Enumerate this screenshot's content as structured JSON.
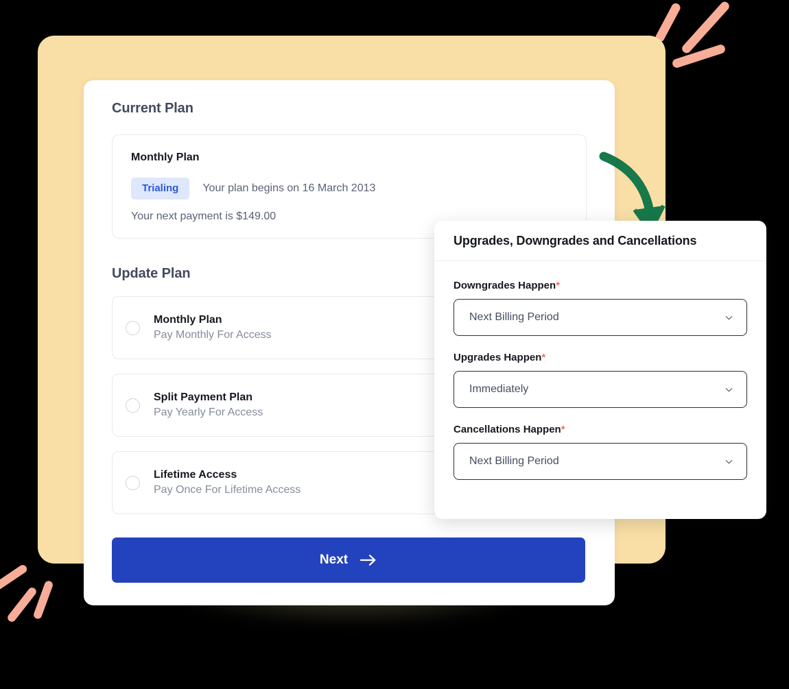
{
  "colors": {
    "background": "#000000",
    "card_yellow": "#F9DFA6",
    "panel_white": "#FFFFFF",
    "primary_blue": "#2343BE",
    "badge_bg": "#DEE7FB",
    "badge_text": "#2E5BD8",
    "arrow_green": "#17784A",
    "coral": "#F7AD97",
    "required_red": "#FF6B5E",
    "heading_slate": "#424A5E",
    "muted_text": "#858C9C"
  },
  "main": {
    "current_plan": {
      "section_title": "Current Plan",
      "plan_name": "Monthly Plan",
      "status_badge": "Trialing",
      "begins_text": "Your plan begins on 16 March 2013",
      "next_payment_text": "Your next payment is $149.00"
    },
    "update_plan": {
      "section_title": "Update Plan",
      "options": [
        {
          "name": "Monthly Plan",
          "description": "Pay Monthly For Access",
          "selected": false
        },
        {
          "name": "Split Payment Plan",
          "description": "Pay Yearly For Access",
          "selected": false
        },
        {
          "name": "Lifetime Access",
          "description": "Pay Once For Lifetime Access",
          "selected": false
        }
      ]
    },
    "next_button": {
      "label": "Next",
      "icon": "arrow-right-icon"
    }
  },
  "settings_panel": {
    "title": "Upgrades, Downgrades and Cancellations",
    "required_mark": "*",
    "fields": [
      {
        "label": "Downgrades Happen",
        "value": "Next Billing Period",
        "icon": "chevron-down-icon"
      },
      {
        "label": "Upgrades Happen",
        "value": "Immediately",
        "icon": "chevron-down-icon"
      },
      {
        "label": "Cancellations Happen",
        "value": "Next Billing Period",
        "icon": "chevron-down-icon"
      }
    ]
  },
  "decorations": {
    "arrow": "curved-arrow-icon",
    "sparkles_top_right": "coral-stroke-decoration",
    "sparkles_bottom_left": "coral-stroke-decoration"
  }
}
